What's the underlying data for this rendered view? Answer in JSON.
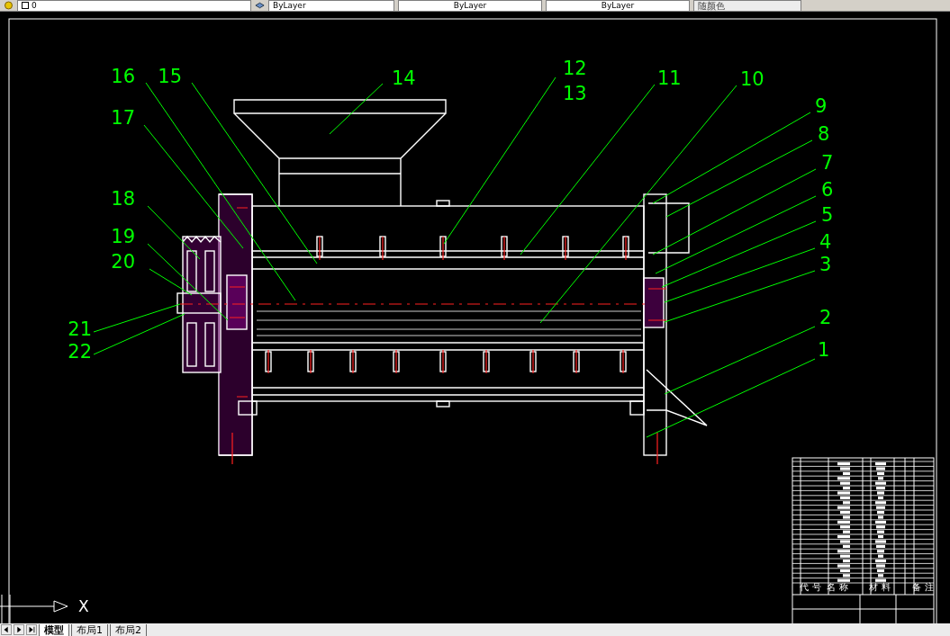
{
  "toolbar": {
    "layer": "0",
    "color_setting": "ByLayer",
    "linetype": "ByLayer",
    "lineweight": "ByLayer",
    "plot_style": "随颜色"
  },
  "drawing": {
    "balloons": [
      {
        "label": "12"
      },
      {
        "label": "16"
      },
      {
        "label": "15"
      },
      {
        "label": "14"
      },
      {
        "label": "11"
      },
      {
        "label": "10"
      },
      {
        "label": "13"
      },
      {
        "label": "9"
      },
      {
        "label": "17"
      },
      {
        "label": "8"
      },
      {
        "label": "7"
      },
      {
        "label": "6"
      },
      {
        "label": "18"
      },
      {
        "label": "5"
      },
      {
        "label": "19"
      },
      {
        "label": "4"
      },
      {
        "label": "20"
      },
      {
        "label": "3"
      },
      {
        "label": "2"
      },
      {
        "label": "21"
      },
      {
        "label": "1"
      },
      {
        "label": "22"
      }
    ],
    "title_block": {
      "headers": [
        "代 号",
        "名 称",
        "材 料",
        "备 注"
      ]
    },
    "ucs_axis": "X"
  },
  "tabs": [
    {
      "label": "模型",
      "selected": true
    },
    {
      "label": "布局1",
      "selected": false
    },
    {
      "label": "布局2",
      "selected": false
    }
  ]
}
